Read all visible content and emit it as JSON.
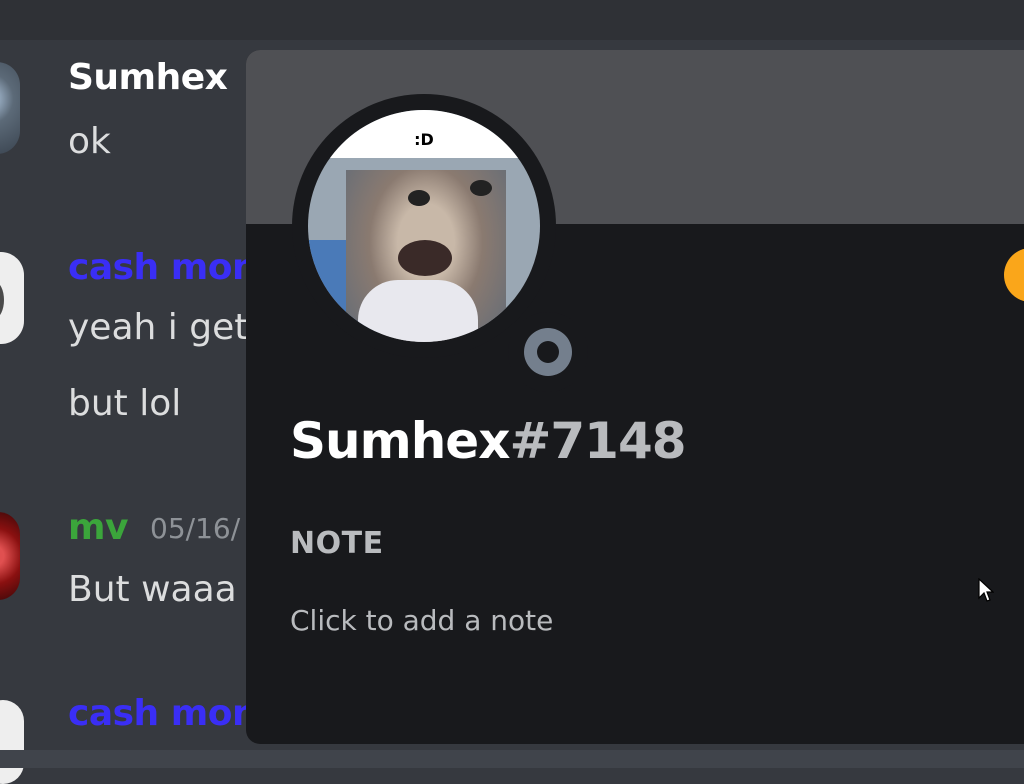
{
  "chat": {
    "messages": [
      {
        "author": "Sumhex",
        "lines": [
          "ok"
        ]
      },
      {
        "author": "cash mon",
        "lines": [
          "yeah i get",
          "but lol"
        ]
      },
      {
        "author": "mv",
        "timestamp": "05/16/",
        "lines": [
          "But waaa"
        ]
      },
      {
        "author": "cash mon",
        "lines": []
      }
    ]
  },
  "profile": {
    "avatar_caption": ":D",
    "username": "Sumhex",
    "discriminator": "#7148",
    "status": "offline",
    "note_label": "NOTE",
    "note_placeholder": "Click to add a note"
  },
  "icons": {
    "status": "offline-status-icon",
    "badge": "orange-badge-icon",
    "cursor": "mouse-cursor-icon"
  },
  "colors": {
    "username_sumhex": "#ffffff",
    "username_cash": "#3a2ef5",
    "username_mv": "#3ba53b",
    "badge": "#faa61a",
    "status_offline": "#747f8d"
  }
}
